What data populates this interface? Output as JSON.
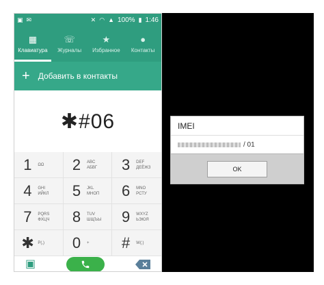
{
  "status_bar": {
    "signal_label": "100%",
    "time": "1:46"
  },
  "tabs": [
    {
      "label": "Клавиатура",
      "icon": "keypad-icon"
    },
    {
      "label": "Журналы",
      "icon": "call-log-icon"
    },
    {
      "label": "Избранное",
      "icon": "star-icon"
    },
    {
      "label": "Контакты",
      "icon": "person-icon"
    }
  ],
  "add_contact": {
    "label": "Добавить в контакты"
  },
  "dialed_number": "✱#06",
  "keypad": [
    {
      "digit": "1",
      "sub1": "ΩΩ",
      "sub2": ""
    },
    {
      "digit": "2",
      "sub1": "ABC",
      "sub2": "АБВГ"
    },
    {
      "digit": "3",
      "sub1": "DEF",
      "sub2": "ДЕЁЖЗ"
    },
    {
      "digit": "4",
      "sub1": "GHI",
      "sub2": "ИЙКЛ"
    },
    {
      "digit": "5",
      "sub1": "JKL",
      "sub2": "МНОП"
    },
    {
      "digit": "6",
      "sub1": "MNO",
      "sub2": "РСТУ"
    },
    {
      "digit": "7",
      "sub1": "PQRS",
      "sub2": "ФХЦЧ"
    },
    {
      "digit": "8",
      "sub1": "TUV",
      "sub2": "ШЩЪЫ"
    },
    {
      "digit": "9",
      "sub1": "WXYZ",
      "sub2": "ЬЭЮЯ"
    },
    {
      "digit": "✱",
      "sub1": "P(,)",
      "sub2": ""
    },
    {
      "digit": "0",
      "sub1": "+",
      "sub2": ""
    },
    {
      "digit": "#",
      "sub1": "W(;)",
      "sub2": ""
    }
  ],
  "imei_dialog": {
    "title": "IMEI",
    "value_suffix": "/ 01",
    "ok_label": "OK"
  },
  "colors": {
    "header": "#2f9d7f",
    "call_button": "#3bb14a"
  }
}
